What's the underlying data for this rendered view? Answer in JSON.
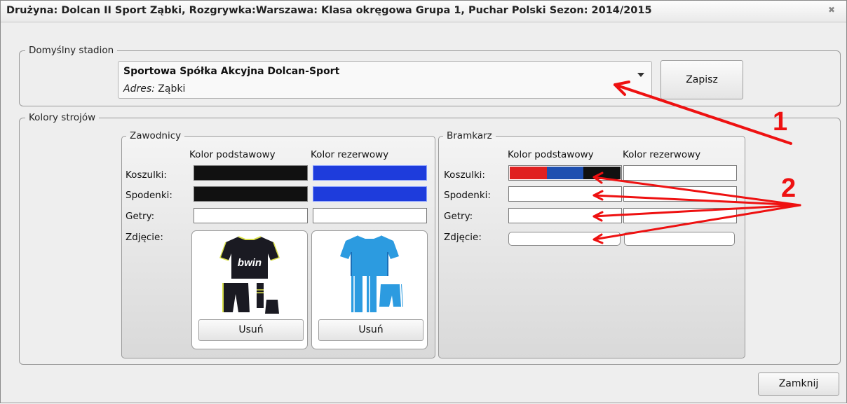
{
  "window": {
    "title": "Drużyna: Dolcan II Sport Ząbki, Rozgrywka:Warszawa: Klasa okręgowa Grupa 1, Puchar Polski Sezon: 2014/2015"
  },
  "stadium": {
    "legend": "Domyślny stadion",
    "selected_name": "Sportowa Spółka Akcyjna Dolcan-Sport",
    "address_label": "Adres:",
    "address_value": "Ząbki",
    "save_label": "Zapisz"
  },
  "kits": {
    "legend": "Kolory strojów",
    "players": {
      "legend": "Zawodnicy",
      "col_primary": "Kolor podstawowy",
      "col_reserve": "Kolor rezerwowy",
      "row_shirts": "Koszulki:",
      "row_shorts": "Spodenki:",
      "row_socks": "Getry:",
      "row_photo": "Zdjęcie:",
      "shirts": {
        "primary_color": "#111111",
        "reserve_color": "#1e3cdc"
      },
      "shorts": {
        "primary_color": "#111111",
        "reserve_color": "#1e3cdc"
      },
      "primary_kit_text": "bwin",
      "delete_primary": "Usuń",
      "delete_reserve": "Usuń"
    },
    "goalkeeper": {
      "legend": "Bramkarz",
      "col_primary": "Kolor podstawowy",
      "col_reserve": "Kolor rezerwowy",
      "row_shirts": "Koszulki:",
      "row_shorts": "Spodenki:",
      "row_socks": "Getry:",
      "row_photo": "Zdjęcie:",
      "shirt_primary_colors": [
        "#e02020",
        "#1e4fb0",
        "#111111"
      ]
    }
  },
  "footer": {
    "close_label": "Zamknij"
  },
  "annotations": {
    "marker_1": "1",
    "marker_2": "2",
    "arrow_color": "#ee1111"
  }
}
